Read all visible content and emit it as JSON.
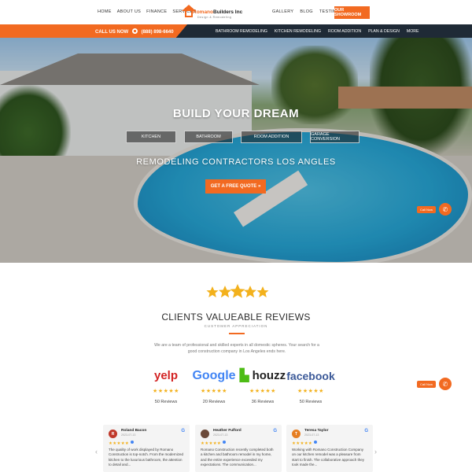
{
  "header": {
    "nav_left": [
      "HOME",
      "ABOUT US",
      "FINANCE",
      "SERVICES"
    ],
    "nav_right": [
      "GALLERY",
      "BLOG",
      "TESTIMONIAL"
    ],
    "logo_name_part1": "Romano",
    "logo_name_part2": "Builders Inc",
    "logo_tagline": "Design & Remodeling",
    "showroom_label": "OUR SHOWROOM"
  },
  "subbar": {
    "call_label": "CALL US NOW",
    "phone": "(888) 898-6640",
    "links": [
      "BATHROOM REMODELING",
      "KITCHEN REMODELING",
      "ROOM ADDITION",
      "PLAN & DESIGN",
      "MORE"
    ]
  },
  "hero": {
    "title": "BUILD YOUR DREAM",
    "categories": [
      "KITCHEN",
      "BATHROOM",
      "ROOM ADDITION",
      "GARAGE CONVERSION"
    ],
    "subtitle": "REMODELING CONTRACTORS LOS ANGLES",
    "cta": "GET A FREE QUOTE »"
  },
  "call_now_label": "Call Now",
  "reviews": {
    "title": "CLIENTS VALUEABLE REVIEWS",
    "subtitle": "CUSTOMER APPRECIATION",
    "intro": "We are a team of professional and skilled experts in all domestic spheres. Your search for a good construction company in Los Angeles ends here.",
    "platforms": [
      {
        "name": "yelp",
        "count": "50 Reviews",
        "color": "#d32323"
      },
      {
        "name": "Google",
        "count": "20 Reviews",
        "color": "#4285f4"
      },
      {
        "name": "houzz",
        "count": "36 Reviews",
        "color": "#222222"
      },
      {
        "name": "facebook",
        "count": "50 Reviews",
        "color": "#3b5998"
      }
    ],
    "stars": "★★★★★",
    "cards": [
      {
        "initial": "R",
        "name": "Roland Bacon",
        "date": "2023-07-13",
        "avatar_color": "#c0392b",
        "text": "The quality of work displayed by Romano Construction is top-notch. From the modernized kitchen to the luxurious bathroom, the attention to detail and..."
      },
      {
        "initial": "",
        "name": "Heather Fulford",
        "date": "2023-07-13",
        "avatar_color": "#6b4a3a",
        "text": "Romano Construction recently completed both a kitchen and bathroom remodel in my home, and the entire experience exceeded my expectations. The communication..."
      },
      {
        "initial": "T",
        "name": "Teresa Taylor",
        "date": "2023-07-13",
        "avatar_color": "#e67e22",
        "text": "Working with Romano Construction Company on our kitchen remodel was a pleasure from start to finish. The collaborative approach they took made the..."
      }
    ]
  },
  "colors": {
    "accent": "#f26a21",
    "navy": "#1f2a36",
    "star": "#f3b11c"
  }
}
